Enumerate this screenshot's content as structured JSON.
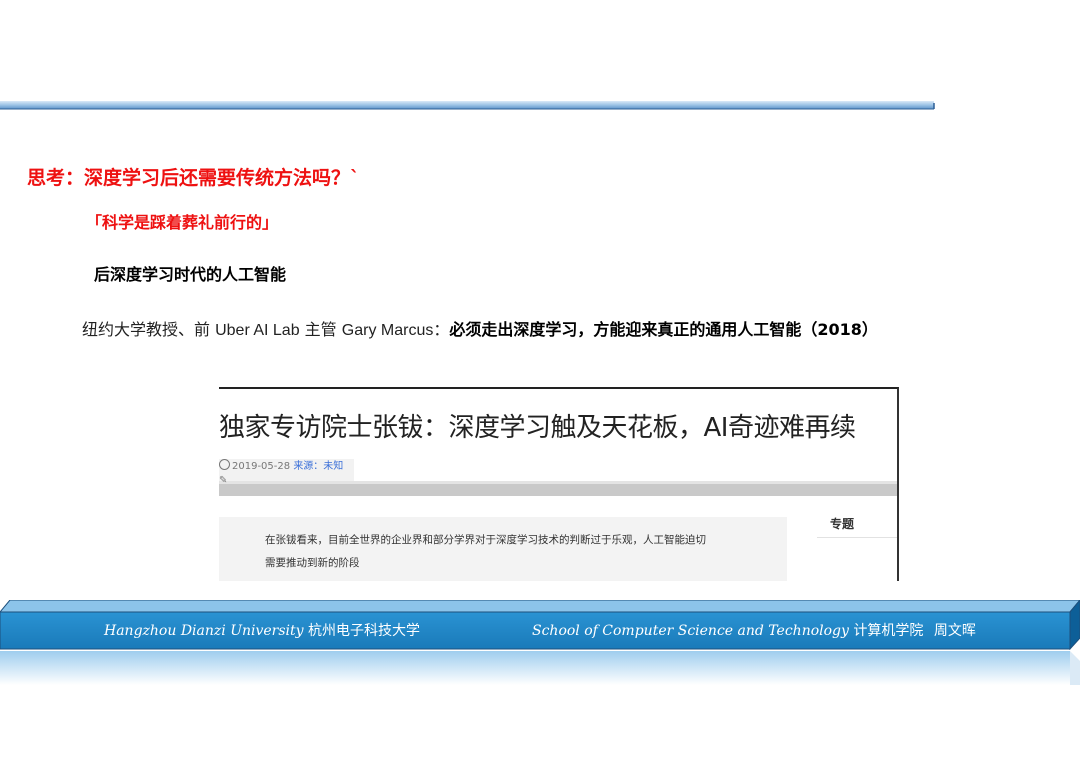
{
  "slide": {
    "title": "思考：深度学习后还需要传统方法吗？`",
    "quote": "「科学是踩着葬礼前行的」",
    "subheading": "后深度学习时代的人工智能",
    "statement": {
      "prefix_cn1": "纽约大学教授、前 ",
      "prefix_en1": "Uber AI Lab",
      "prefix_cn2": " 主管 ",
      "prefix_en2": "Gary Marcus：",
      "bold_text": "必须走出深度学习，方能迎来真正的通用人工智能（2018）"
    }
  },
  "article_screenshot": {
    "headline": "独家专访院士张钹：深度学习触及天花板，AI奇迹难再续",
    "date": "2019-05-28",
    "source": "来源：未知",
    "body_line1": "在张钹看来，目前全世界的企业界和部分学界对于深度学习技术的判断过于乐观，人工智能迫切",
    "body_line2": "需要推动到新的阶段",
    "sidebar_label": "专题"
  },
  "footer": {
    "university_en": "Hangzhou Dianzi University",
    "university_cn": "杭州电子科技大学",
    "school_en": "School of Computer Science  and Technology",
    "school_cn": "计算机学院",
    "author": "周文晖"
  },
  "colors": {
    "title_red": "#ee1111",
    "band_blue": "#1f86c8",
    "band_dark": "#0d5f98"
  }
}
